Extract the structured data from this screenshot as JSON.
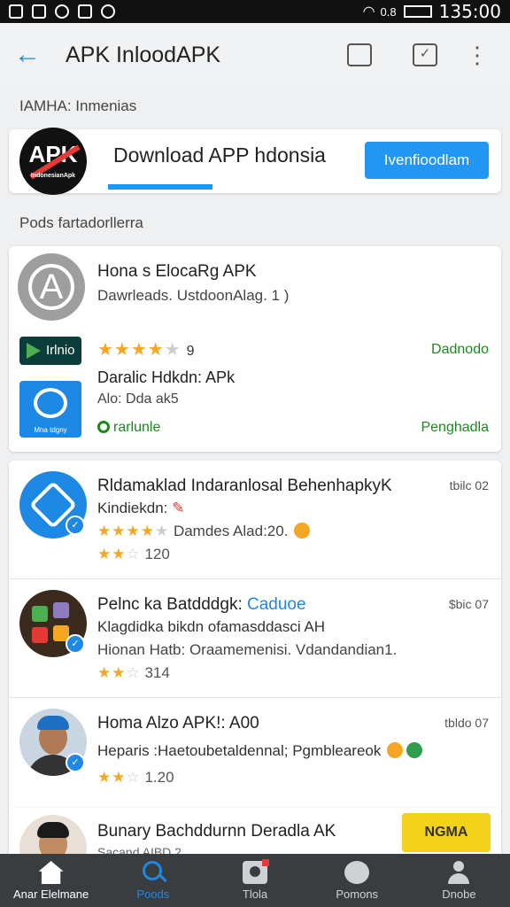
{
  "status": {
    "time": "135:00",
    "signal": "0.8"
  },
  "header": {
    "title": "APK InloodAPK"
  },
  "section1": {
    "label": "IAMHA: Inmenias"
  },
  "banner": {
    "logo_text": "APK",
    "logo_sub": "IndonesianApk",
    "title": "Download APP hdonsia",
    "button": "Ivenfioodlam"
  },
  "section2": {
    "label": "Pods fartadorllerra"
  },
  "featured": {
    "name": "Hona s ElocaRg APK",
    "subtitle": "Dawrleads. UstdoonAlag. 1 )",
    "play_label": "Irlnio",
    "rating_value": "9",
    "rating_right": "Dadnodo",
    "name2": "Daralic Hdkdn: APk",
    "sub2": "Alo: Dda ak5",
    "blue_caption": "Mna tdgny",
    "tag": "rarlunle",
    "tag_right": "Penghadla"
  },
  "list": [
    {
      "name": "Rldamaklad Indaranlosal BehenhapkyK",
      "price": "tbilc 02",
      "line2": "Kindiekdn:",
      "line3": "Damdes Alad:20.",
      "rating_text": "120"
    },
    {
      "name": "Pelnc ka Batdddgk:",
      "name_blue": "Caduoe",
      "price": "$bic 07",
      "line2": "Klagdidka bikdn ofamasddasci AH",
      "line3": "Hionan  Hatb: Oraamemenisi. Vdandandian1.",
      "rating_text": "314"
    },
    {
      "name": "Homa Alzo APK!:  A00",
      "price": "tbldo 07",
      "line2": "Heparis :Haetoubetaldennal; Pgmbleareok",
      "rating_text": "1.20"
    },
    {
      "name": "Bunary Bachddurnn Deradla AK",
      "button": "NGMA",
      "line2": "Sacand AIBD 2"
    }
  ],
  "nav": [
    {
      "label": "Anar Elelmane"
    },
    {
      "label": "Poods"
    },
    {
      "label": "Tlola"
    },
    {
      "label": "Pomons"
    },
    {
      "label": "Dnobe"
    }
  ],
  "colors": {
    "accent": "#2196f3",
    "status_bar": "#111111",
    "nav_bar": "#3a3d40",
    "green": "#1b8a1b",
    "yellow_button": "#f2d21b"
  }
}
